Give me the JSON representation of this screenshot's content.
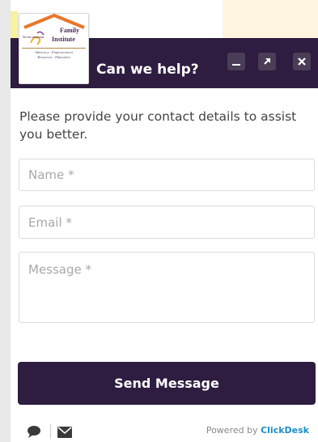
{
  "header": {
    "title": "Can we help?",
    "buttons": {
      "minimize_icon": "minimize-icon",
      "expand_icon": "expand-arrow-icon",
      "close_icon": "close-icon"
    }
  },
  "logo": {
    "brand_line1": "Family",
    "brand_line2": "Institute",
    "small_text": "The Arc Arkansas",
    "tagline_line1": "Advocacy · Empowerment",
    "tagline_line2": "Resources · Education"
  },
  "form": {
    "intro": "Please provide your contact details to assist you better.",
    "name_placeholder": "Name *",
    "email_placeholder": "Email *",
    "message_placeholder": "Message *",
    "send_label": "Send Message"
  },
  "footer": {
    "powered_prefix": "Powered by ",
    "powered_brand": "ClickDesk",
    "icons": [
      "chat-icon",
      "mail-icon"
    ]
  },
  "colors": {
    "header_bg": "#2e1d40",
    "button_bg": "#2e1d40",
    "brand_link": "#1a8ec8"
  }
}
